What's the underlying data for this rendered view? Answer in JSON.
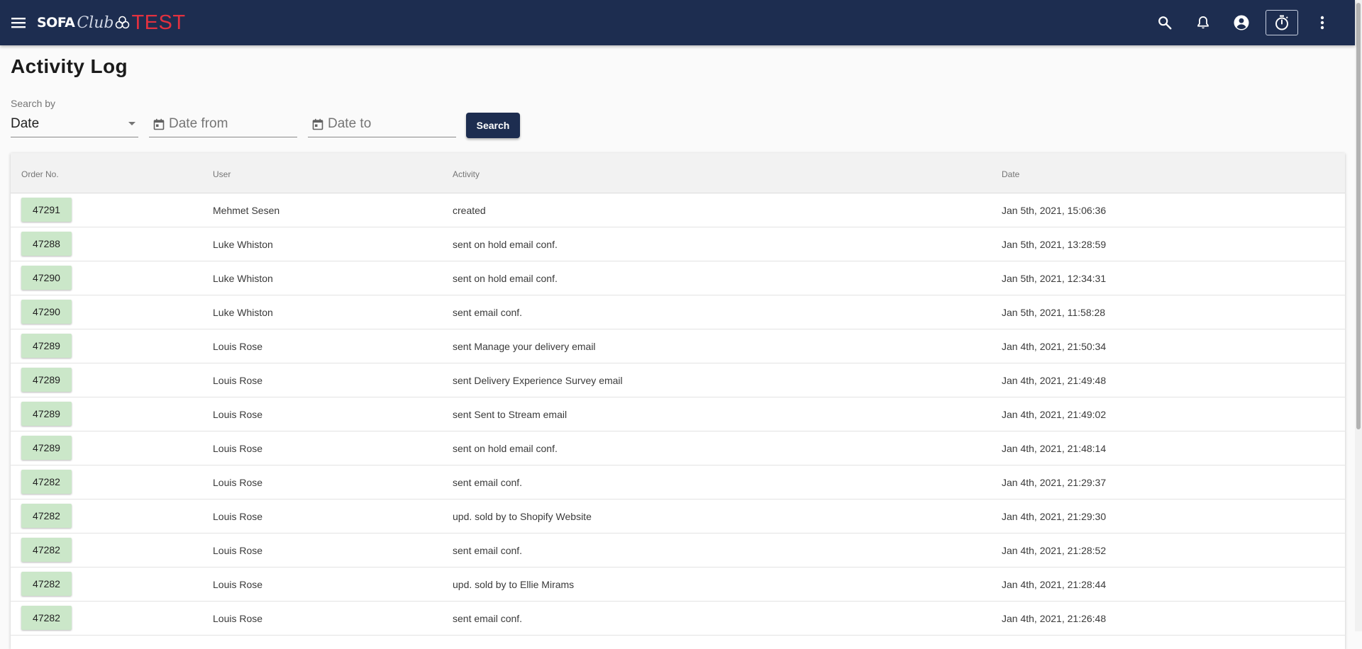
{
  "app": {
    "logo_sofa": "SOFA",
    "logo_club": "Club",
    "logo_test": "TEST"
  },
  "topbar": {
    "icons": [
      "menu-icon",
      "search-icon",
      "bell-icon",
      "account-circle-icon",
      "timer-icon",
      "more-vert-icon"
    ]
  },
  "page": {
    "title": "Activity Log"
  },
  "filters": {
    "search_by_label": "Search by",
    "search_by_value": "Date",
    "date_from_placeholder": "Date from",
    "date_to_placeholder": "Date to",
    "search_button": "Search"
  },
  "table": {
    "columns": [
      "Order No.",
      "User",
      "Activity",
      "Date"
    ],
    "rows": [
      {
        "order": "47291",
        "user": "Mehmet Sesen",
        "activity": "created",
        "date": "Jan 5th, 2021, 15:06:36"
      },
      {
        "order": "47288",
        "user": "Luke Whiston",
        "activity": "sent on hold email conf.",
        "date": "Jan 5th, 2021, 13:28:59"
      },
      {
        "order": "47290",
        "user": "Luke Whiston",
        "activity": "sent on hold email conf.",
        "date": "Jan 5th, 2021, 12:34:31"
      },
      {
        "order": "47290",
        "user": "Luke Whiston",
        "activity": "sent email conf.",
        "date": "Jan 5th, 2021, 11:58:28"
      },
      {
        "order": "47289",
        "user": "Louis Rose",
        "activity": "sent Manage your delivery email",
        "date": "Jan 4th, 2021, 21:50:34"
      },
      {
        "order": "47289",
        "user": "Louis Rose",
        "activity": "sent Delivery Experience Survey email",
        "date": "Jan 4th, 2021, 21:49:48"
      },
      {
        "order": "47289",
        "user": "Louis Rose",
        "activity": "sent Sent to Stream email",
        "date": "Jan 4th, 2021, 21:49:02"
      },
      {
        "order": "47289",
        "user": "Louis Rose",
        "activity": "sent on hold email conf.",
        "date": "Jan 4th, 2021, 21:48:14"
      },
      {
        "order": "47282",
        "user": "Louis Rose",
        "activity": "sent email conf.",
        "date": "Jan 4th, 2021, 21:29:37"
      },
      {
        "order": "47282",
        "user": "Louis Rose",
        "activity": "upd. sold by to Shopify Website",
        "date": "Jan 4th, 2021, 21:29:30"
      },
      {
        "order": "47282",
        "user": "Louis Rose",
        "activity": "sent email conf.",
        "date": "Jan 4th, 2021, 21:28:52"
      },
      {
        "order": "47282",
        "user": "Louis Rose",
        "activity": "upd. sold by to Ellie Mirams",
        "date": "Jan 4th, 2021, 21:28:44"
      },
      {
        "order": "47282",
        "user": "Louis Rose",
        "activity": "sent email conf.",
        "date": "Jan 4th, 2021, 21:26:48"
      }
    ]
  },
  "colors": {
    "topbar_bg": "#1d2d50",
    "logo_test": "#e2313f",
    "order_chip_bg": "#cbe7c9",
    "search_button_bg": "#1d2d50"
  }
}
